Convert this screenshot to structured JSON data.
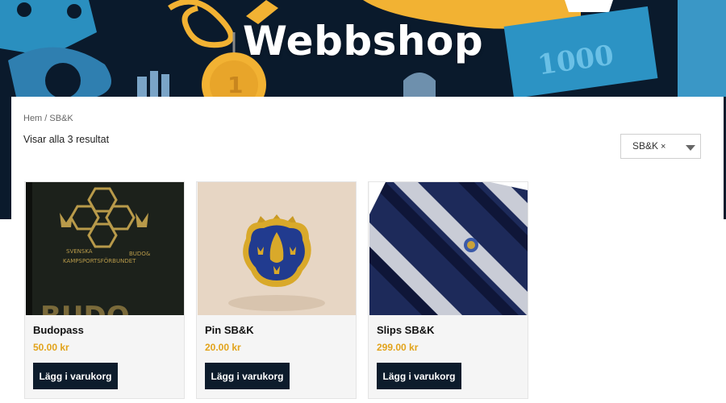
{
  "hero": {
    "title": "Webbshop"
  },
  "breadcrumb": {
    "home": "Hem",
    "separator": " / ",
    "current": "SB&K"
  },
  "results": {
    "text": "Visar alla 3 resultat"
  },
  "filter": {
    "selected": "SB&K",
    "remove_icon": "×"
  },
  "products": [
    {
      "name": "Budopass",
      "price": "50.00 kr",
      "button": "Lägg i varukorg",
      "image_text_line1": "SVENSKA",
      "image_text_line2": "BUDO&",
      "image_text_line3": "KAMPSPORTSFÖRBUNDET",
      "image_text_large": "BUDO"
    },
    {
      "name": "Pin SB&K",
      "price": "20.00 kr",
      "button": "Lägg i varukorg"
    },
    {
      "name": "Slips SB&K",
      "price": "299.00 kr",
      "button": "Lägg i varukorg"
    }
  ],
  "colors": {
    "accent_price": "#e2a31b",
    "button_bg": "#0d1c2c",
    "hero_bg": "#0a1a2c"
  }
}
